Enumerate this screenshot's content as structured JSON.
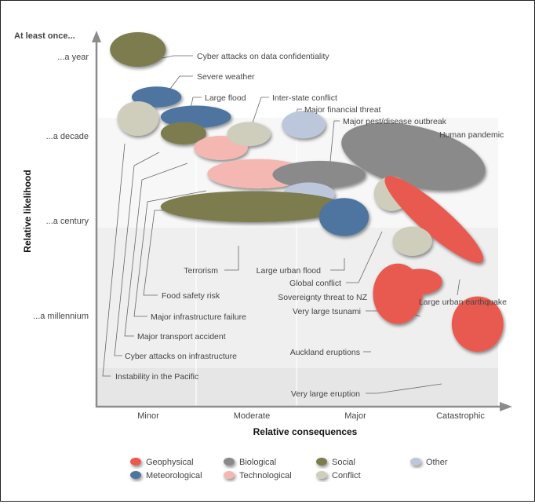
{
  "chart_data": {
    "type": "scatter",
    "subtype": "bubble-ellipse risk matrix",
    "title": "",
    "xlabel": "Relative consequences",
    "ylabel": "Relative likelihood",
    "y_header": "At least once...",
    "x_ticks": [
      "Minor",
      "Moderate",
      "Major",
      "Catastrophic"
    ],
    "y_ticks": [
      "...a year",
      "...a decade",
      "...a century",
      "...a millennium"
    ],
    "grid": false,
    "legend_position": "bottom",
    "categories": [
      {
        "name": "Geophysical",
        "color": "#e85a4f"
      },
      {
        "name": "Meteorological",
        "color": "#4e74a0"
      },
      {
        "name": "Biological",
        "color": "#8a8a8a"
      },
      {
        "name": "Technological",
        "color": "#f4b7b2"
      },
      {
        "name": "Social",
        "color": "#7c7c50"
      },
      {
        "name": "Conflict",
        "color": "#cfcdbb"
      },
      {
        "name": "Other",
        "color": "#bcc7dc"
      }
    ],
    "legend_order": [
      "Geophysical",
      "Biological",
      "Social",
      "Other",
      "Meteorological",
      "Technological",
      "Conflict"
    ],
    "risks": [
      {
        "name": "Cyber attacks on data confidentiality",
        "category": "Social",
        "x": 0.4,
        "y": 3.1,
        "wx": 0.27,
        "hy": 0.2,
        "rot": 0
      },
      {
        "name": "Severe weather",
        "category": "Meteorological",
        "x": 0.58,
        "y": 2.55,
        "wx": 0.24,
        "hy": 0.12,
        "rot": 0
      },
      {
        "name": "Large flood",
        "category": "Meteorological",
        "x": 0.96,
        "y": 2.32,
        "wx": 0.34,
        "hy": 0.13,
        "rot": 0
      },
      {
        "name": "Instability in the Pacific",
        "category": "Conflict",
        "x": 0.4,
        "y": 2.3,
        "wx": 0.2,
        "hy": 0.2,
        "rot": 0
      },
      {
        "name": "Cyber attacks on infrastructure",
        "category": "Social",
        "x": 0.84,
        "y": 2.13,
        "wx": 0.22,
        "hy": 0.13,
        "rot": 0
      },
      {
        "name": "Major transport accident",
        "category": "Technological",
        "x": 1.2,
        "y": 1.96,
        "wx": 0.26,
        "hy": 0.14,
        "rot": 0
      },
      {
        "name": "Inter-state conflict",
        "category": "Conflict",
        "x": 1.47,
        "y": 2.12,
        "wx": 0.21,
        "hy": 0.14,
        "rot": 0
      },
      {
        "name": "Major financial threat",
        "category": "Other",
        "x": 2.0,
        "y": 2.23,
        "wx": 0.21,
        "hy": 0.16,
        "rot": 0
      },
      {
        "name": "Major infrastructure failure",
        "category": "Technological",
        "x": 1.56,
        "y": 1.66,
        "wx": 0.49,
        "hy": 0.17,
        "rot": 0
      },
      {
        "name": "Major pest/disease outbreak",
        "category": "Biological",
        "x": 2.15,
        "y": 1.65,
        "wx": 0.45,
        "hy": 0.16,
        "rot": 0
      },
      {
        "name": "Human pandemic",
        "category": "Biological",
        "x": 3.06,
        "y": 1.86,
        "wx": 0.71,
        "hy": 0.35,
        "rot": 13
      },
      {
        "name": "Food safety risk",
        "category": "Other",
        "x": 2.05,
        "y": 1.42,
        "wx": 0.25,
        "hy": 0.14,
        "rot": 0
      },
      {
        "name": "Terrorism",
        "category": "Social",
        "x": 1.51,
        "y": 1.28,
        "wx": 0.89,
        "hy": 0.18,
        "rot": 0
      },
      {
        "name": "Large urban flood",
        "category": "Meteorological",
        "x": 2.39,
        "y": 1.16,
        "wx": 0.24,
        "hy": 0.22,
        "rot": 0
      },
      {
        "name": "Global conflict",
        "category": "Conflict",
        "x": 2.85,
        "y": 1.43,
        "wx": 0.17,
        "hy": 0.2,
        "rot": 0
      },
      {
        "name": "Large urban earthquake",
        "category": "Geophysical",
        "x": 3.26,
        "y": 1.13,
        "wx": 0.62,
        "hy": 0.17,
        "rot": 41
      },
      {
        "name": "Sovereignty threat to NZ",
        "category": "Conflict",
        "x": 3.05,
        "y": 0.88,
        "wx": 0.19,
        "hy": 0.17,
        "rot": 0
      },
      {
        "name": "Very large tsunami",
        "category": "Geophysical",
        "x": 3.12,
        "y": 0.41,
        "wx": 0.22,
        "hy": 0.15,
        "rot": 0
      },
      {
        "name": "Auckland eruptions",
        "category": "Geophysical",
        "x": 2.91,
        "y": 0.27,
        "wx": 0.24,
        "hy": 0.35,
        "rot": 0
      },
      {
        "name": "Very large eruption",
        "category": "Geophysical",
        "x": 3.68,
        "y": -0.08,
        "wx": 0.25,
        "hy": 0.32,
        "rot": 0
      }
    ],
    "notes": "x axis: 0=Minor, 1=Moderate, 2=Major, 3=Catastrophic (plus offset). y axis: 3=year, 2=decade, 1=century, 0=millennium. Values estimated from ellipse centres; wx/hy are ellipse semi-extents in axis units."
  }
}
